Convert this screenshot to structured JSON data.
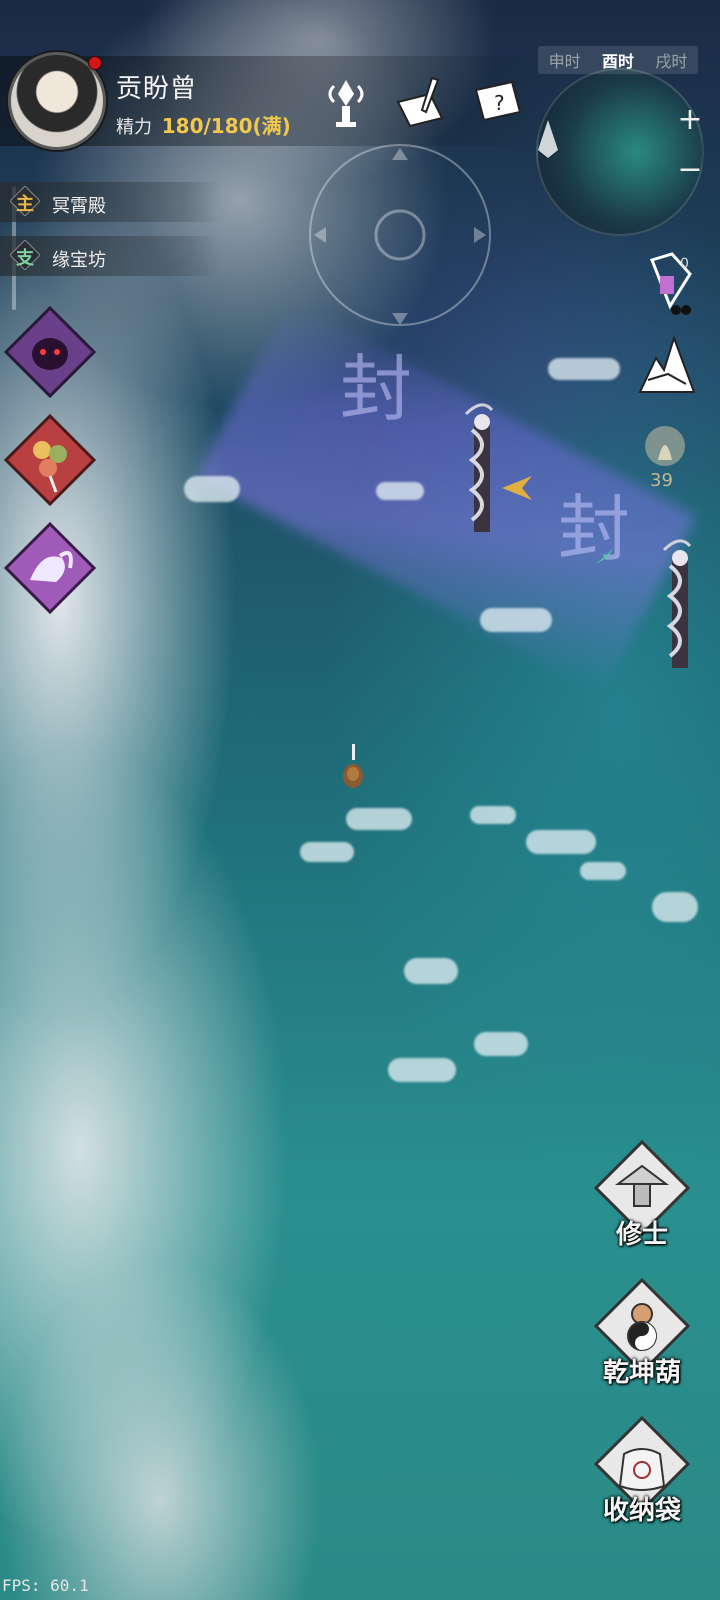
{
  "player": {
    "name": "贡盼曾",
    "energy_label": "精力",
    "energy_value": "180/180(满)",
    "has_notification": true
  },
  "top_icons": [
    "cultivation-tower-icon",
    "letter-brush-icon",
    "scroll-question-icon"
  ],
  "time_bar": {
    "items": [
      "申时",
      "酉时",
      "戌时"
    ],
    "active_index": 1
  },
  "minimap": {
    "zoom_in": "+",
    "zoom_out": "−"
  },
  "quests": [
    {
      "type": "主",
      "title": "冥霄殿",
      "color": "#e8b74a"
    },
    {
      "type": "支",
      "title": "缘宝坊",
      "color": "#7fd0a0"
    }
  ],
  "skills": [
    "demon-mask-icon",
    "candied-fruit-icon",
    "spirit-beast-icon"
  ],
  "right_side": {
    "pet_count": "0",
    "item_count": "39"
  },
  "map": {
    "seal_glyphs": [
      "封",
      "封"
    ]
  },
  "actions": [
    {
      "label": "修士",
      "icon": "cultivator-icon"
    },
    {
      "label": "乾坤葫",
      "icon": "gourd-icon"
    },
    {
      "label": "收纳袋",
      "icon": "storage-bag-icon"
    }
  ],
  "fps": "FPS: 60.1"
}
